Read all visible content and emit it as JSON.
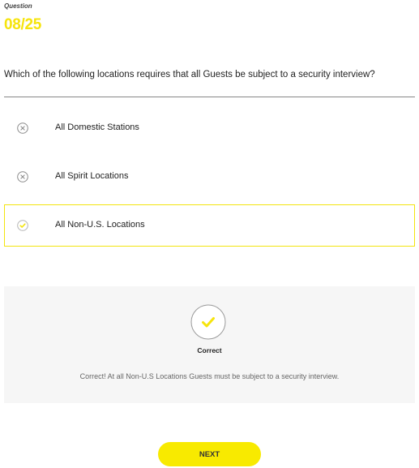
{
  "question": {
    "label": "Question",
    "counter": "08/25",
    "text": "Which of the following locations requires that all Guests be subject to a security interview?"
  },
  "options": [
    {
      "label": "All Domestic Stations",
      "state": "incorrect",
      "icon": "x-circle-icon"
    },
    {
      "label": "All Spirit Locations",
      "state": "incorrect",
      "icon": "x-circle-icon"
    },
    {
      "label": "All Non-U.S. Locations",
      "state": "selected-correct",
      "icon": "check-circle-icon"
    }
  ],
  "feedback": {
    "icon": "checkmark-icon",
    "title": "Correct",
    "text": "Correct! At all Non-U.S Locations Guests must be subject to a security interview."
  },
  "next_button": {
    "label": "NEXT"
  },
  "colors": {
    "accent": "#f8ea00",
    "counter": "#f6e40c",
    "feedback_bg": "#f6f6f6"
  }
}
